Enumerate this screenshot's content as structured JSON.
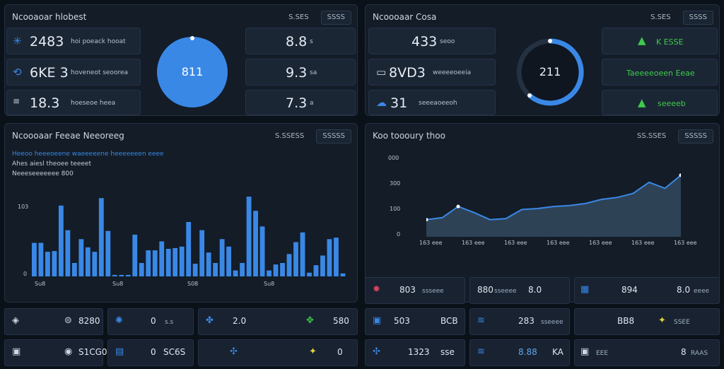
{
  "colors": {
    "accent": "#3a88e6",
    "green": "#3fca4a",
    "warn": "#e0d23a",
    "red": "#d3445e"
  },
  "panel1": {
    "title": "Ncooaoar hlobest",
    "ctrl1": "S.SES",
    "ctrl2": "SSSS",
    "rows": [
      {
        "icon": "sync-icon",
        "value": "2483",
        "unit": "hoi poeack hooat"
      },
      {
        "icon": "refresh-icon",
        "value": "6KE 3",
        "unit": "hoveneot seoorea"
      },
      {
        "icon": "list-icon",
        "value": "18.3",
        "unit": "hoeseoe heea"
      }
    ],
    "donut": "811",
    "stats": [
      {
        "value": "8.8",
        "unit": "s"
      },
      {
        "value": "9.3",
        "unit": "sa"
      },
      {
        "value": "7.3",
        "unit": "a"
      }
    ]
  },
  "panel2": {
    "title": "Ncoooaar Cosa",
    "ctrl1": "S.SES",
    "ctrl2": "SSSS",
    "left": [
      {
        "value": "433",
        "unit": "seoo"
      },
      {
        "value": "8VD3",
        "unit": "weeeeoeeia"
      },
      {
        "value": "31",
        "unit": "seeeaoeeoh"
      }
    ],
    "donut": "211",
    "right": [
      {
        "label": "K ESSE"
      },
      {
        "label": "Taeeeeoeen Eeae"
      },
      {
        "label": "seeeeb"
      }
    ]
  },
  "panel3": {
    "title": "Ncoooaar Feeae Neeoreeg",
    "ctrl1": "S.SSESS",
    "ctrl2": "SSSSS",
    "legend": [
      "Heeoo heeeoeene waeeeeene heeeeeeen eeee",
      "Ahes aiesl  theoee teeeet",
      "Neeeseeeeeee 800"
    ],
    "yticks": [
      "103",
      "0"
    ],
    "xticks": [
      "Su8",
      "Su8",
      "S08",
      "Su8"
    ]
  },
  "panel4": {
    "title": "Koo toooury thoo",
    "ctrl1": "SS.SSES",
    "ctrl2": "SSSSS",
    "yticks": [
      "000",
      "300",
      "100",
      "0"
    ],
    "xticks": [
      "163 eee",
      "163 eee",
      "163 eee",
      "163 eee",
      "163 eee",
      "163 eee",
      "163 eee"
    ]
  },
  "minis_left": [
    {
      "a": "0",
      "b": "8280"
    },
    {
      "a": "0",
      "b": "s.s"
    },
    {
      "a": "2.0",
      "b": "580"
    },
    {
      "a": "0",
      "b": "S1CG0"
    },
    {
      "a": "0",
      "b": "SC6S"
    },
    {
      "a": "0",
      "b": "0"
    }
  ],
  "minis_right": [
    {
      "a": "803",
      "b": "ssseee"
    },
    {
      "a": "880",
      "b": "sseeee"
    },
    {
      "a": "8.0",
      "b": "sssee"
    },
    {
      "a": "894",
      "b": "eeee"
    },
    {
      "a": "503",
      "b": "BCB"
    },
    {
      "a": "283",
      "b": "sseeee"
    },
    {
      "a": "BB8",
      "b": "SSEE"
    },
    {
      "a": "8KN",
      "b": "eee"
    },
    {
      "a": "1323",
      "b": "sse"
    },
    {
      "a": "8.88",
      "b": "KA"
    },
    {
      "a": "KA",
      "b": "RAAS"
    },
    {
      "a": "8",
      "b": "EEE"
    }
  ],
  "chart_data": [
    {
      "type": "bar",
      "title": "",
      "series": [
        {
          "name": "",
          "values": [
            45,
            45,
            33,
            34,
            95,
            62,
            18,
            50,
            39,
            33,
            105,
            61,
            2,
            2,
            2,
            56,
            18,
            35,
            35,
            47,
            37,
            38,
            40,
            73,
            17,
            62,
            32,
            18,
            50,
            40,
            8,
            18,
            107,
            88,
            67,
            8,
            16,
            18,
            30,
            46,
            59,
            5,
            15,
            28,
            50,
            52,
            4
          ]
        }
      ],
      "ylim": [
        0,
        110
      ]
    },
    {
      "type": "area",
      "title": "",
      "x": [
        1,
        2,
        3,
        4,
        5,
        6,
        7,
        8,
        9,
        10,
        11,
        12,
        13,
        14,
        15
      ],
      "values": [
        85,
        95,
        150,
        120,
        85,
        90,
        135,
        140,
        150,
        155,
        165,
        185,
        195,
        215,
        270,
        240,
        305
      ],
      "ylim": [
        0,
        350
      ]
    }
  ]
}
